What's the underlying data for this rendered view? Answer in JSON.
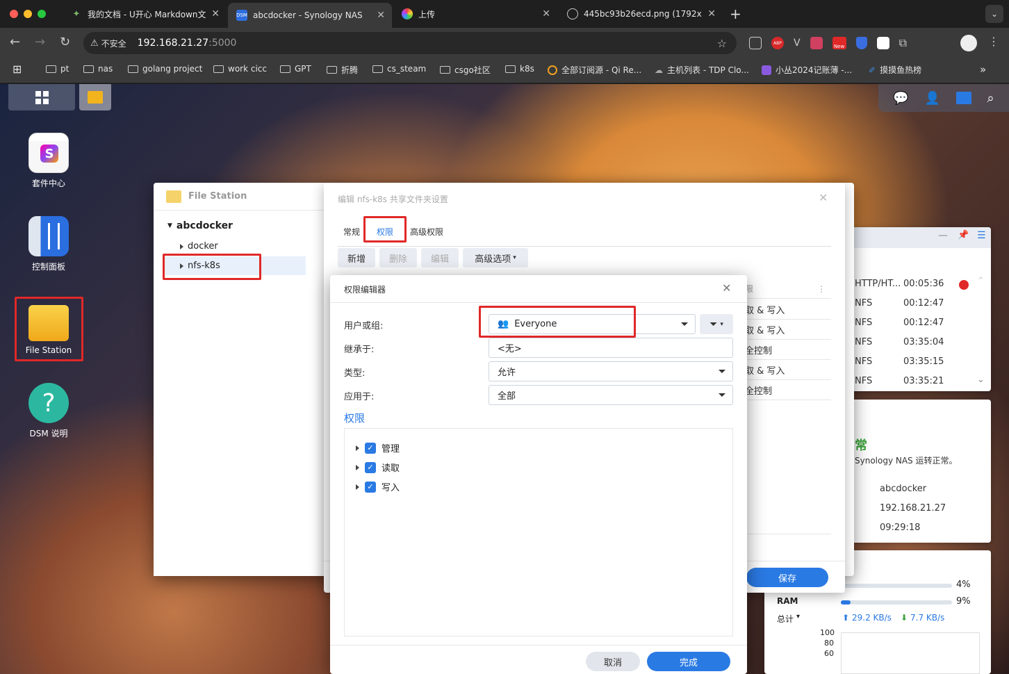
{
  "browser": {
    "tabs": [
      {
        "title": "我的文档 - U开心 Markdown文",
        "favicon": "leaf-icon",
        "active": false
      },
      {
        "title": "abcdocker - Synology NAS",
        "favicon": "dsm-icon",
        "active": true
      },
      {
        "title": "上传",
        "favicon": "pinwheel-icon",
        "active": false
      },
      {
        "title": "445bc93b26ecd.png (1792x",
        "favicon": "globe-icon",
        "active": false
      }
    ],
    "dsm_favicon_text": "DSM",
    "insecure_label": "不安全",
    "url_host": "192.168.21.27",
    "url_port": ":5000",
    "ext_abp": "ABP",
    "ext_new": "New",
    "bookmarks": [
      "pt",
      "nas",
      "golang project",
      "work cicc",
      "GPT",
      "折腾",
      "cs_steam",
      "csgo社区",
      "k8s",
      "全部订阅源 - Qi Re...",
      "主机列表 - TDP Clo...",
      "小丛2024记账薄 -...",
      "摸摸鱼热榜"
    ]
  },
  "desktop": {
    "icons": [
      {
        "label": "套件中心",
        "name": "package-center"
      },
      {
        "label": "控制面板",
        "name": "control-panel"
      },
      {
        "label": "File Station",
        "name": "file-station"
      },
      {
        "label": "DSM 说明",
        "name": "dsm-help"
      }
    ]
  },
  "file_station": {
    "title": "File Station",
    "tree": {
      "root": "abcdocker",
      "children": [
        "docker",
        "nfs-k8s"
      ]
    }
  },
  "share_dialog": {
    "title": "编辑 nfs-k8s 共享文件夹设置",
    "tabs": [
      "常规",
      "权限",
      "高级权限"
    ],
    "toolbar": {
      "add": "新增",
      "delete": "删除",
      "edit": "编辑",
      "advanced": "高级选项"
    },
    "table_header": "限",
    "rows": [
      "取 & 写入",
      "取 & 写入",
      "全控制",
      "取 & 写入",
      "全控制"
    ],
    "save": "保存"
  },
  "permission_editor": {
    "title": "权限编辑器",
    "user_group_label": "用户或组:",
    "user_group_value": "Everyone",
    "inherit_label": "继承于:",
    "inherit_value": "<无>",
    "type_label": "类型:",
    "type_value": "允许",
    "apply_label": "应用于:",
    "apply_value": "全部",
    "permissions_heading": "权限",
    "permissions": [
      {
        "label": "管理",
        "checked": true
      },
      {
        "label": "读取",
        "checked": true
      },
      {
        "label": "写入",
        "checked": true
      }
    ],
    "cancel": "取消",
    "done": "完成"
  },
  "connections_widget": {
    "rows": [
      {
        "type": "HTTP/HT...",
        "time": "00:05:36"
      },
      {
        "type": "NFS",
        "time": "00:12:47"
      },
      {
        "type": "NFS",
        "time": "00:12:47"
      },
      {
        "type": "NFS",
        "time": "03:35:04"
      },
      {
        "type": "NFS",
        "time": "03:35:15"
      },
      {
        "type": "NFS",
        "time": "03:35:21"
      }
    ]
  },
  "health_widget": {
    "status_fragment": "常",
    "message": "Synology NAS 运转正常。",
    "server_name": "abcdocker",
    "ip": "192.168.21.27",
    "uptime": "09:29:18"
  },
  "resource_widget": {
    "cpu_percent": "4%",
    "cpu_fraction": 0.04,
    "ram_label": "RAM",
    "ram_percent": "9%",
    "ram_fraction": 0.09,
    "total_label": "总计",
    "upload": "29.2 KB/s",
    "download": "7.7 KB/s",
    "y_ticks": [
      "100",
      "80",
      "60"
    ]
  },
  "colors": {
    "accent": "#2a7ae4",
    "highlight_box": "#e02828",
    "ok_green": "#3aa23a"
  }
}
